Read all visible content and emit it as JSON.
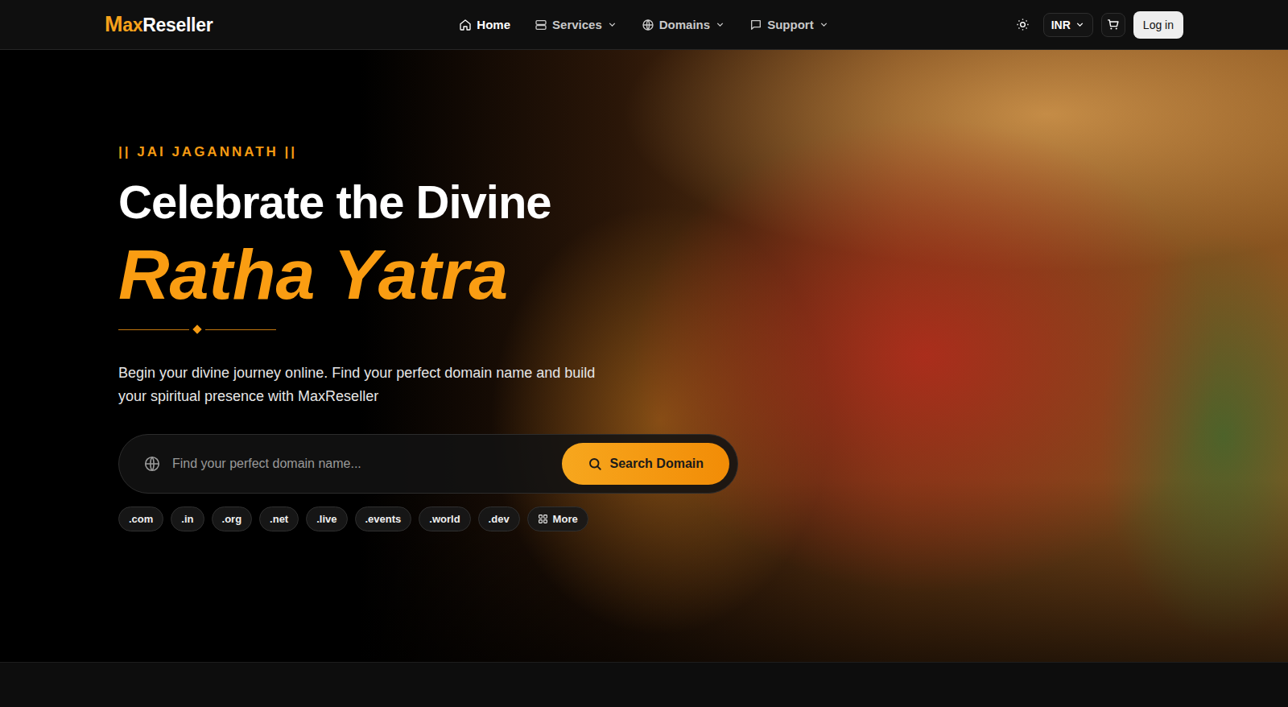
{
  "logo": {
    "mark": "M",
    "accent": "ax",
    "rest": "Reseller"
  },
  "nav": [
    {
      "label": "Home",
      "selected": true,
      "dropdown": false,
      "icon": "home"
    },
    {
      "label": "Services",
      "selected": false,
      "dropdown": true,
      "icon": "server"
    },
    {
      "label": "Domains",
      "selected": false,
      "dropdown": true,
      "icon": "globe"
    },
    {
      "label": "Support",
      "selected": false,
      "dropdown": true,
      "icon": "chat"
    }
  ],
  "currency": "INR",
  "login": "Log in",
  "hero": {
    "eyebrow": "|| JAI JAGANNATH ||",
    "title": "Celebrate the Divine",
    "highlight": "Ratha Yatra",
    "description": "Begin your divine journey online. Find your perfect domain name and build your spiritual presence with MaxReseller"
  },
  "search": {
    "placeholder": "Find your perfect domain name...",
    "button": "Search Domain"
  },
  "tlds": [
    ".com",
    ".in",
    ".org",
    ".net",
    ".live",
    ".events",
    ".world",
    ".dev"
  ],
  "more": "More"
}
